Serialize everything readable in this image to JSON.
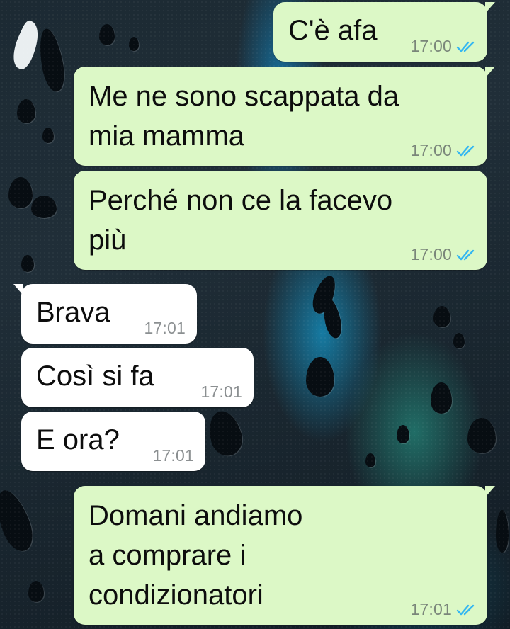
{
  "conversation": {
    "messages": [
      {
        "direction": "outgoing",
        "text": "C'è afa",
        "time": "17:00",
        "status": "read"
      },
      {
        "direction": "outgoing",
        "text": "Me ne sono scappata da\nmia mamma",
        "time": "17:00",
        "status": "read"
      },
      {
        "direction": "outgoing",
        "text": "Perché non ce la facevo\npiù",
        "time": "17:00",
        "status": "read"
      },
      {
        "direction": "incoming",
        "text": "Brava",
        "time": "17:01"
      },
      {
        "direction": "incoming",
        "text": "Così si fa",
        "time": "17:01"
      },
      {
        "direction": "incoming",
        "text": "E ora?",
        "time": "17:01"
      },
      {
        "direction": "outgoing",
        "text": "Domani andiamo\na comprare i\ncondizionatori",
        "time": "17:01",
        "status": "read"
      }
    ]
  },
  "colors": {
    "outgoing_bubble": "#dcf8c6",
    "incoming_bubble": "#ffffff",
    "read_receipt": "#34b7f1",
    "timestamp": "#7a867a"
  },
  "icons": {
    "read_receipt": "double-check-icon"
  }
}
